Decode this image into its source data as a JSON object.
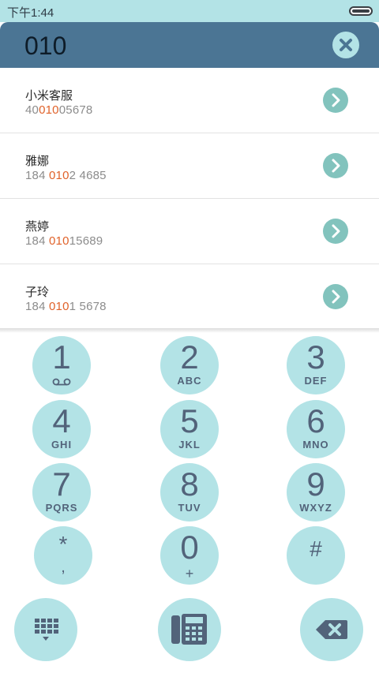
{
  "status_bar": {
    "time": "下午1:44"
  },
  "search": {
    "query": "010"
  },
  "results": [
    {
      "name": "小米客服",
      "number_pre": "40",
      "number_match": "010",
      "number_post": "05678"
    },
    {
      "name": "雅娜",
      "number_pre": "184 ",
      "number_match": "010",
      "number_post": "2 4685"
    },
    {
      "name": "燕婷",
      "number_pre": "184 ",
      "number_match": "010",
      "number_post": "15689"
    },
    {
      "name": "子玲",
      "number_pre": "184 ",
      "number_match": "010",
      "number_post": "1 5678"
    }
  ],
  "keypad": {
    "keys": [
      {
        "digit": "1",
        "letters": ""
      },
      {
        "digit": "2",
        "letters": "ABC"
      },
      {
        "digit": "3",
        "letters": "DEF"
      },
      {
        "digit": "4",
        "letters": "GHI"
      },
      {
        "digit": "5",
        "letters": "JKL"
      },
      {
        "digit": "6",
        "letters": "MNO"
      },
      {
        "digit": "7",
        "letters": "PQRS"
      },
      {
        "digit": "8",
        "letters": "TUV"
      },
      {
        "digit": "9",
        "letters": "WXYZ"
      },
      {
        "digit": "*",
        "letters": ","
      },
      {
        "digit": "0",
        "letters": "+"
      },
      {
        "digit": "#",
        "letters": ""
      }
    ]
  },
  "colors": {
    "accent": "#b3e3e6",
    "header": "#4b7594",
    "highlight": "#e0622a",
    "key_text": "#52637a",
    "arrow_button": "#82c3bd"
  },
  "icons": {
    "clear": "close-icon",
    "row_action": "chevron-right-icon",
    "dialpad_toggle": "dialpad-icon",
    "call": "desk-phone-icon",
    "backspace": "backspace-icon",
    "voicemail": "voicemail-icon",
    "battery": "battery-icon"
  }
}
